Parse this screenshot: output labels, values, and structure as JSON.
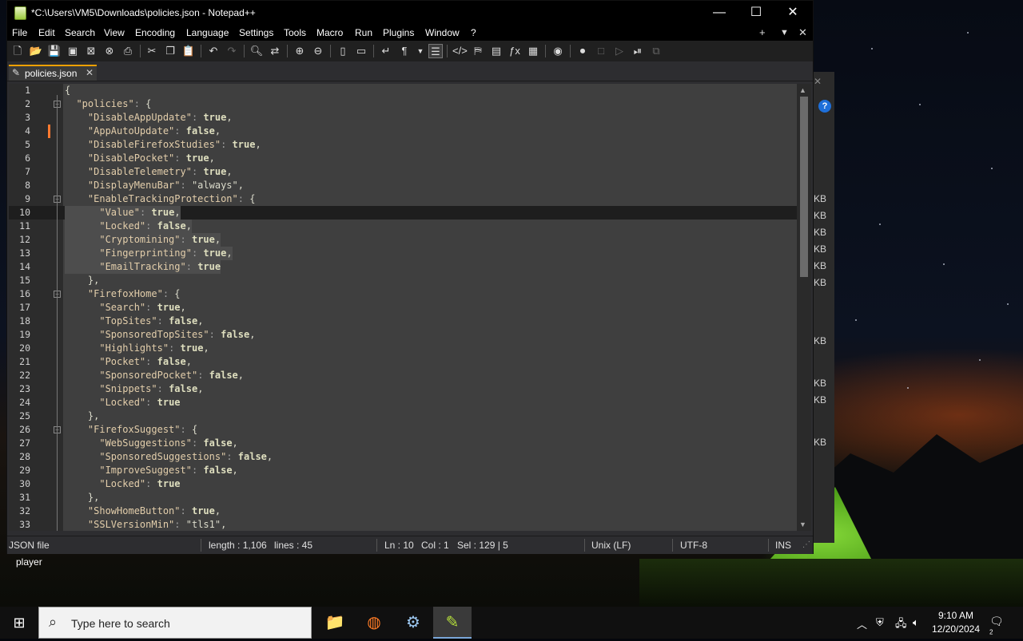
{
  "window": {
    "title": "*C:\\Users\\VM5\\Downloads\\policies.json - Notepad++",
    "controls": {
      "minimize": "—",
      "maximize": "☐",
      "close": "✕"
    }
  },
  "menu": {
    "items": [
      "File",
      "Edit",
      "Search",
      "View",
      "Encoding",
      "Language",
      "Settings",
      "Tools",
      "Macro",
      "Run",
      "Plugins",
      "Window",
      "?"
    ],
    "right": {
      "add": "+",
      "dropdown": "▼",
      "close": "✕"
    }
  },
  "tab": {
    "label": "policies.json",
    "close": "✕"
  },
  "editor": {
    "lines": [
      {
        "n": "1",
        "code": "{"
      },
      {
        "n": "2",
        "code": "  \"policies\": {"
      },
      {
        "n": "3",
        "code": "    \"DisableAppUpdate\": true,"
      },
      {
        "n": "4",
        "code": "    \"AppAutoUpdate\": false,"
      },
      {
        "n": "5",
        "code": "    \"DisableFirefoxStudies\": true,"
      },
      {
        "n": "6",
        "code": "    \"DisablePocket\": true,"
      },
      {
        "n": "7",
        "code": "    \"DisableTelemetry\": true,"
      },
      {
        "n": "8",
        "code": "    \"DisplayMenuBar\": \"always\","
      },
      {
        "n": "9",
        "code": "    \"EnableTrackingProtection\": {"
      },
      {
        "n": "10",
        "code": "      \"Value\": true,"
      },
      {
        "n": "11",
        "code": "      \"Locked\": false,"
      },
      {
        "n": "12",
        "code": "      \"Cryptomining\": true,"
      },
      {
        "n": "13",
        "code": "      \"Fingerprinting\": true,"
      },
      {
        "n": "14",
        "code": "      \"EmailTracking\": true"
      },
      {
        "n": "15",
        "code": "    },"
      },
      {
        "n": "16",
        "code": "    \"FirefoxHome\": {"
      },
      {
        "n": "17",
        "code": "      \"Search\": true,"
      },
      {
        "n": "18",
        "code": "      \"TopSites\": false,"
      },
      {
        "n": "19",
        "code": "      \"SponsoredTopSites\": false,"
      },
      {
        "n": "20",
        "code": "      \"Highlights\": true,"
      },
      {
        "n": "21",
        "code": "      \"Pocket\": false,"
      },
      {
        "n": "22",
        "code": "      \"SponsoredPocket\": false,"
      },
      {
        "n": "23",
        "code": "      \"Snippets\": false,"
      },
      {
        "n": "24",
        "code": "      \"Locked\": true"
      },
      {
        "n": "25",
        "code": "    },"
      },
      {
        "n": "26",
        "code": "    \"FirefoxSuggest\": {"
      },
      {
        "n": "27",
        "code": "      \"WebSuggestions\": false,"
      },
      {
        "n": "28",
        "code": "      \"SponsoredSuggestions\": false,"
      },
      {
        "n": "29",
        "code": "      \"ImproveSuggest\": false,"
      },
      {
        "n": "30",
        "code": "      \"Locked\": true"
      },
      {
        "n": "31",
        "code": "    },"
      },
      {
        "n": "32",
        "code": "    \"ShowHomeButton\": true,"
      },
      {
        "n": "33",
        "code": "    \"SSLVersionMin\": \"tls1\","
      }
    ]
  },
  "status": {
    "filetype": "JSON file",
    "length": "length : 1,106",
    "lines": "lines : 45",
    "ln": "Ln : 10",
    "col": "Col : 1",
    "sel": "Sel : 129 | 5",
    "eol": "Unix (LF)",
    "encoding": "UTF-8",
    "mode": "INS"
  },
  "background_window": {
    "kb_labels": [
      "KB",
      "KB",
      "KB",
      "KB",
      "KB",
      "KB",
      "KB",
      "KB",
      "KB",
      "KB"
    ]
  },
  "desktop": {
    "label": "player"
  },
  "taskbar": {
    "start": "⊞",
    "search_placeholder": "Type here to search",
    "time": "9:10 AM",
    "date": "12/20/2024",
    "notifications": "2"
  },
  "colors": {
    "accent_tab": "#f0a000",
    "editor_bg": "#3f3f3f",
    "selection": "#4d4d4d",
    "change_marker": "#ff7a30"
  }
}
